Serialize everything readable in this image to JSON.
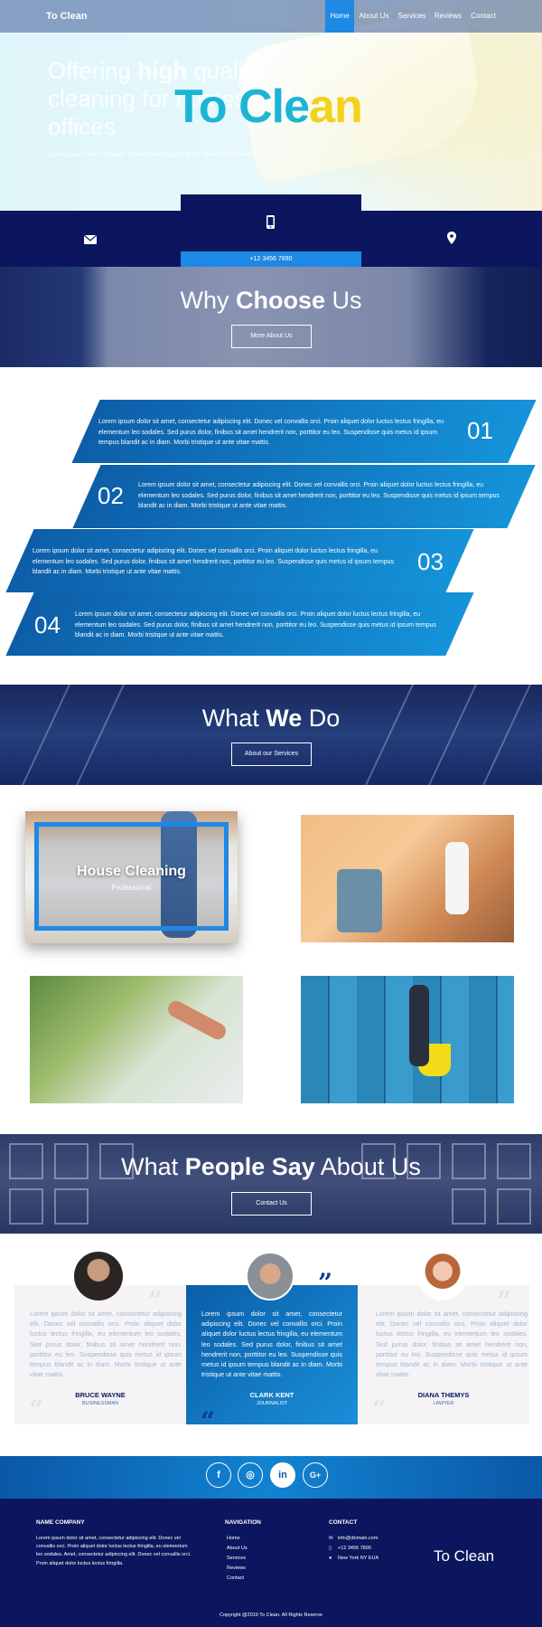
{
  "header": {
    "brand": "To Clean",
    "nav": [
      {
        "label": "Home",
        "active": true
      },
      {
        "label": "About Us"
      },
      {
        "label": "Services"
      },
      {
        "label": "Reviews"
      },
      {
        "label": "Contact"
      }
    ]
  },
  "hero": {
    "heading_pre": "Offering ",
    "heading_bold": "high",
    "heading_post": " quality cleaning for homes and offices",
    "logo_a": "To Cle",
    "logo_b": "an",
    "subtitle": "Lorem ipsum dolor sit amet, consectetur adipiscing elit. Donec vel convallis orci."
  },
  "contact_bar": {
    "phone": "+12 3456 7890",
    "icons": [
      "envelope-icon",
      "mobile-icon",
      "map-pin-icon"
    ]
  },
  "why": {
    "title_a": "Why ",
    "title_b": "Choose",
    "title_c": " Us",
    "button": "More About Us"
  },
  "features": [
    {
      "num": "01",
      "text": "Lorem ipsum dolor sit amet, consectetur adipiscing elit. Donec vel convallis orci. Proin aliquet dolor luctus lectus fringilla, eu elementum leo sodales. Sed purus dolor, finibus sit amet hendrerit non, porttitor eu leo. Suspendisse quis metus id ipsum tempus blandit ac in diam. Morbi tristique ut ante vitae mattis."
    },
    {
      "num": "02",
      "text": "Lorem ipsum dolor sit amet, consectetur adipiscing elit. Donec vel convallis orci. Proin aliquet dolor luctus lectus fringilla, eu elementum leo sodales. Sed purus dolor, finibus sit amet hendrerit non, porttitor eu leo. Suspendisse quis metus id ipsum tempus blandit ac in diam. Morbi tristique ut ante vitae mattis."
    },
    {
      "num": "03",
      "text": "Lorem ipsum dolor sit amet, consectetur adipiscing elit. Donec vel convallis orci. Proin aliquet dolor luctus lectus fringilla, eu elementum leo sodales. Sed purus dolor, finibus sit amet hendrerit non, porttitor eu leo. Suspendisse quis metus id ipsum tempus blandit ac in diam. Morbi tristique ut ante vitae mattis."
    },
    {
      "num": "04",
      "text": "Lorem ipsum dolor sit amet, consectetur adipiscing elit. Donec vel convallis orci. Proin aliquet dolor luctus lectus fringilla, eu elementum leo sodales. Sed purus dolor, finibus sit amet hendrerit non, porttitor eu leo. Suspendisse quis metus id ipsum tempus blandit ac in diam. Morbi tristique ut ante vitae mattis."
    }
  ],
  "wedo": {
    "title_a": "What ",
    "title_b": "We",
    "title_c": " Do",
    "button": "About our Services"
  },
  "gallery": {
    "featured_title": "House Cleaning",
    "featured_subtitle": "Professional"
  },
  "say": {
    "title_a": "What ",
    "title_b": "People Say",
    "title_c": " About Us",
    "button": "Contact Us"
  },
  "testimonials": [
    {
      "text": "Lorem ipsum dolor sit amet, consectetur adipiscing elit. Donec vel convallis orci. Proin aliquet dolor luctus lectus fringilla, eu elementum leo sodales. Sed purus dolor, finibus sit amet hendrerit non, porttitor eu leo. Suspendisse quis metus id ipsum tempus blandit ac in diam. Morbi tristique ut ante vitae mattis.",
      "name": "BRUCE WAYNE",
      "role": "BUSINESSMAN"
    },
    {
      "text": "Lorem ipsum dolor sit amet, consectetur adipiscing elit. Donec vel convallis orci. Proin aliquet dolor luctus lectus fringilla, eu elementum leo sodales. Sed purus dolor, finibus sit amet hendrerit non, porttitor eu leo. Suspendisse quis metus id ipsum tempus blandit ac in diam. Morbi tristique ut ante vitae mattis.",
      "name": "CLARK KENT",
      "role": "JOURNALIST"
    },
    {
      "text": "Lorem ipsum dolor sit amet, consectetur adipiscing elit. Donec vel convallis orci. Proin aliquet dolor luctus lectus fringilla, eu elementum leo sodales. Sed purus dolor, finibus sit amet hendrerit non, porttitor eu leo. Suspendisse quis metus id ipsum tempus blandit ac in diam. Morbi tristique ut ante vitae mattis.",
      "name": "DIANA THEMYS",
      "role": "LAWYER"
    }
  ],
  "social": [
    {
      "icon": "facebook-icon",
      "glyph": "f"
    },
    {
      "icon": "instagram-icon",
      "glyph": "◎"
    },
    {
      "icon": "linkedin-icon",
      "glyph": "in"
    },
    {
      "icon": "google-plus-icon",
      "glyph": "G+"
    }
  ],
  "footer": {
    "company_heading": "NAME COMPANY",
    "company_text": "Lorem ipsum dolor sit amet, consectetur adipiscing elit. Donec vel convallis orci. Proin aliquet dolor luctus lectus fringilla, eu elementum leo sodales. Amet, consectetur adipiscing elit. Donec vel convallis orci. Proin aliquet dolor luctus lectus fringilla.",
    "nav_heading": "NAVIGATION",
    "nav_links": [
      "Home",
      "About Us",
      "Services",
      "Reviews",
      "Contact"
    ],
    "contact_heading": "CONTACT",
    "email": "info@domain.com",
    "phone": "+12 3456 7890",
    "address": "New York NY EUA",
    "logo": "To Clean",
    "copyright": "Copyright @2019 To Clean. All Rights Reserve"
  },
  "colors": {
    "navy": "#0b165e",
    "blue": "#1e88e5",
    "accent_cyan": "#1cb5d6",
    "accent_yellow": "#f2d21b"
  }
}
